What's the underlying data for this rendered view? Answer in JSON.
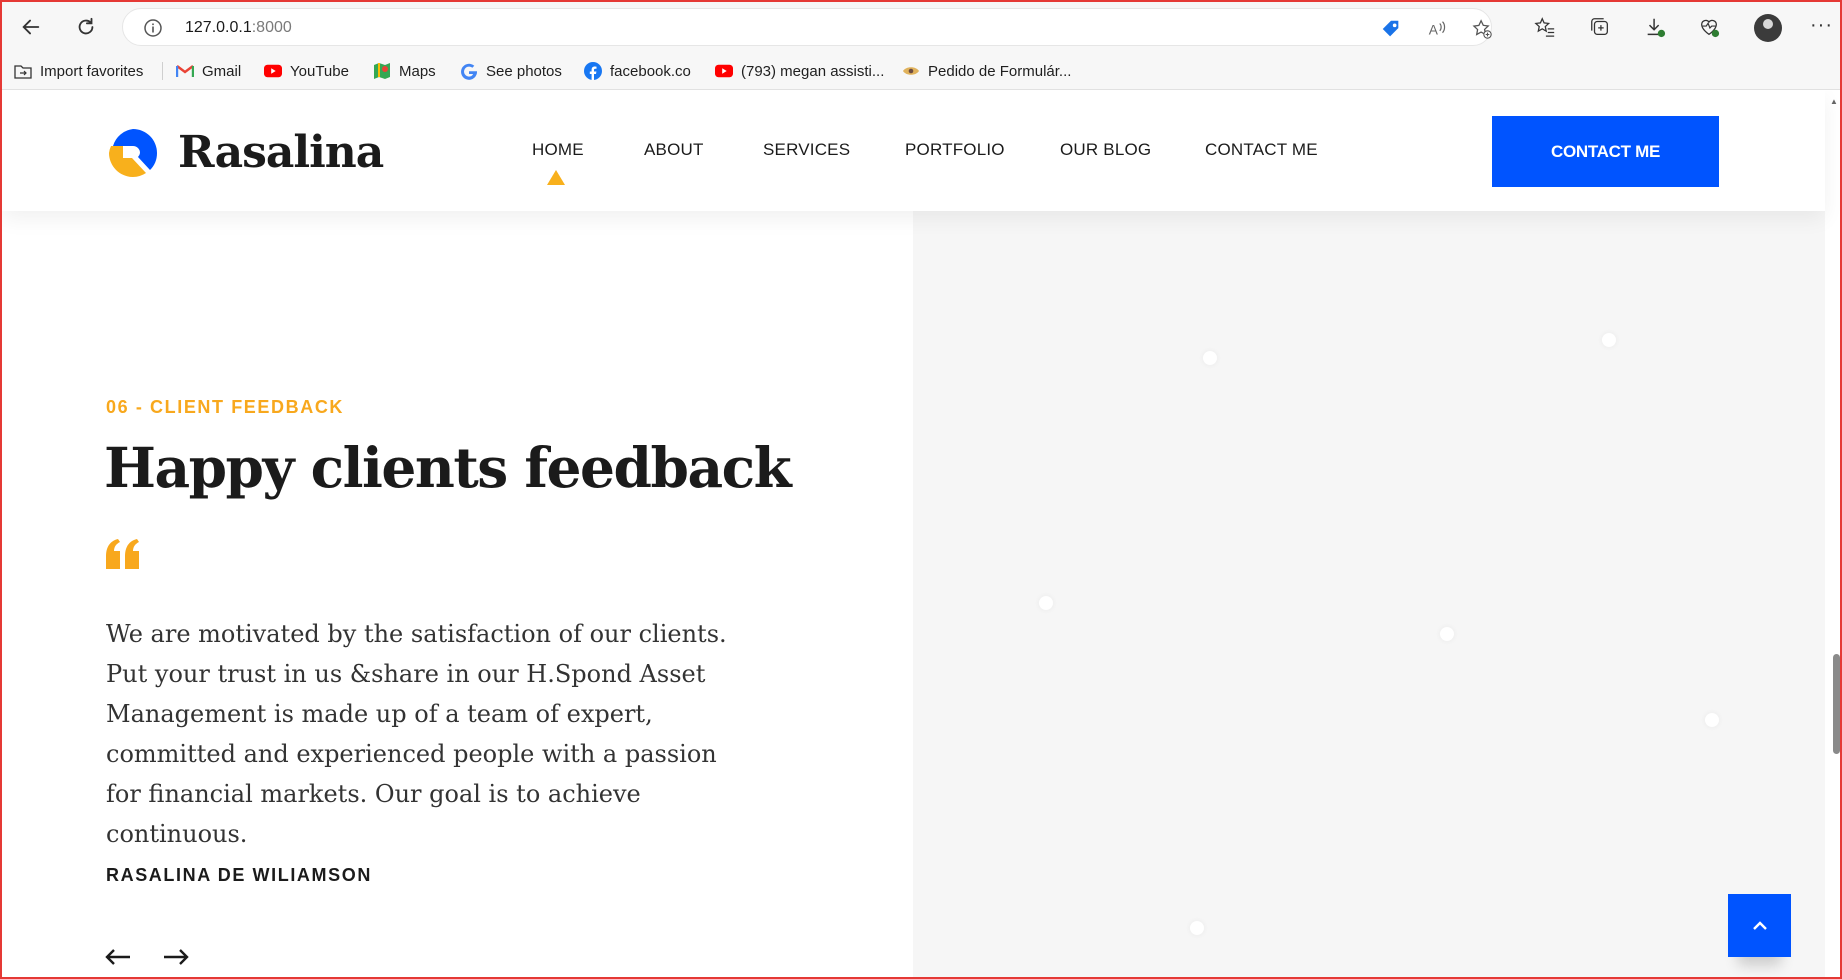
{
  "browser": {
    "url_host": "127.0.0.1",
    "url_port": ":8000",
    "more_label": "···"
  },
  "bookmarks": [
    {
      "label": "Import favorites",
      "icon": "import-folder-icon"
    },
    {
      "label": "Gmail",
      "icon": "gmail-icon"
    },
    {
      "label": "YouTube",
      "icon": "youtube-icon"
    },
    {
      "label": "Maps",
      "icon": "maps-icon"
    },
    {
      "label": "See photos",
      "icon": "google-icon"
    },
    {
      "label": "facebook.co",
      "icon": "facebook-icon"
    },
    {
      "label": "(793) megan assisti...",
      "icon": "youtube-icon"
    },
    {
      "label": "Pedido de Formulár...",
      "icon": "eye-icon"
    }
  ],
  "site": {
    "brand": "Rasalina",
    "menu": [
      "HOME",
      "ABOUT",
      "SERVICES",
      "PORTFOLIO",
      "OUR BLOG",
      "CONTACT ME"
    ],
    "active_menu": "HOME",
    "cta_label": "CONTACT ME"
  },
  "feedback": {
    "tag": "06 - CLIENT FEEDBACK",
    "title": "Happy clients feedback",
    "quote": "We are motivated by the satisfaction of our clients. Put your trust in us &share in our H.Spond Asset Management is made up of a team of expert, committed and experienced people with a passion for financial markets. Our goal is to achieve continuous.",
    "author": "RASALINA DE WILIAMSON"
  },
  "colors": {
    "accent": "#f8a81d",
    "primary": "#0054ff",
    "panel": "#f6f6f6"
  }
}
